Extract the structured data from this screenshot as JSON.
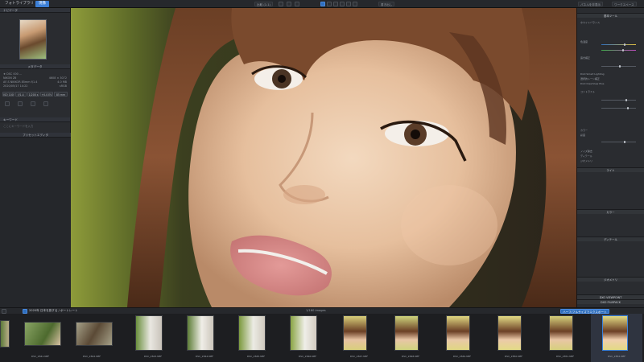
{
  "topbar": {
    "tab_library": "フォトライブラリ",
    "tab_develop": "現像",
    "compare_btn": "比較 (1:1)",
    "export_btn": "書き出し",
    "right_btn1": "パネルを非表示",
    "right_btn2": "ワークスペース"
  },
  "left": {
    "nav_header": "ナビゲータ",
    "meta_header": "メタデータ",
    "meta_lines": [
      "★ DSC 000 ...",
      "NIKON Z6",
      "AF-S NIKKOR 85mm f/1.4",
      "2020/05/17 14:22"
    ],
    "meta_right": [
      "4608 × 3072",
      "4.0 MB",
      "sRGB"
    ],
    "exif": [
      "ISO 100",
      "f/1.4",
      "1/200 s",
      "+0.0 EV",
      "85 mm"
    ],
    "keyword_header": "キーワード",
    "keyword_hint": "ここにキーワードを入力",
    "preset_header": "プリセットエディタ"
  },
  "right": {
    "header": "基本ツール",
    "rows": [
      "ホワイトバランス",
      "色温度",
      "色かぶり補正",
      "露光補正",
      "DxO Smart Lighting",
      "選択的トーン補正",
      "DxO ClearView Plus",
      "コントラスト",
      "カラー",
      "彩度",
      "ノイズ除去",
      "ディテール",
      "ジオメトリ"
    ],
    "section_light": "ライト",
    "section_color": "カラー",
    "section_detail": "ディテール",
    "section_geometry": "ジオメトリ",
    "viewpoint": "DXO VIEWPOINT",
    "filmpack": "DXO FILMPACK",
    "bottom_btn": "ハーフ/フルサイズでエクスポート",
    "accent": "#3a82dc"
  },
  "filmbar": {
    "path": "2020年 日本を旅する / ポートレート",
    "count": "1/160 images"
  },
  "film": {
    "labels": [
      "DSC_2841.NEF",
      "DSC_2842.NEF",
      "DSC_2843.NEF",
      "DSC_2844.NEF",
      "DSC_2845.NEF",
      "DSC_2846.NEF",
      "DSC_2847.NEF",
      "DSC_2848.NEF",
      "DSC_2849.NEF",
      "DSC_2850.NEF",
      "DSC_2851.NEF",
      "DSC_2852.NEF"
    ]
  }
}
